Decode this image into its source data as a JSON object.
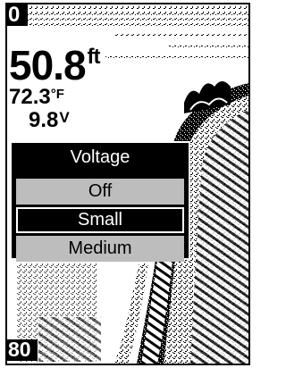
{
  "display": {
    "depth_scale_top": "0",
    "depth_scale_bottom": "80",
    "depth_value": "50.8",
    "depth_unit": "ft",
    "temperature_value": "72.3",
    "temperature_unit": "°F",
    "voltage_value": "9.8",
    "voltage_unit": "V"
  },
  "menu": {
    "title": "Voltage",
    "options": [
      {
        "label": "Off",
        "state": "normal"
      },
      {
        "label": "Small",
        "state": "selected"
      },
      {
        "label": "Medium",
        "state": "normal"
      }
    ]
  },
  "colors": {
    "background": "#ffffff",
    "foreground": "#000000",
    "menu_option": "#bdbdbd",
    "selected": "#000000"
  }
}
